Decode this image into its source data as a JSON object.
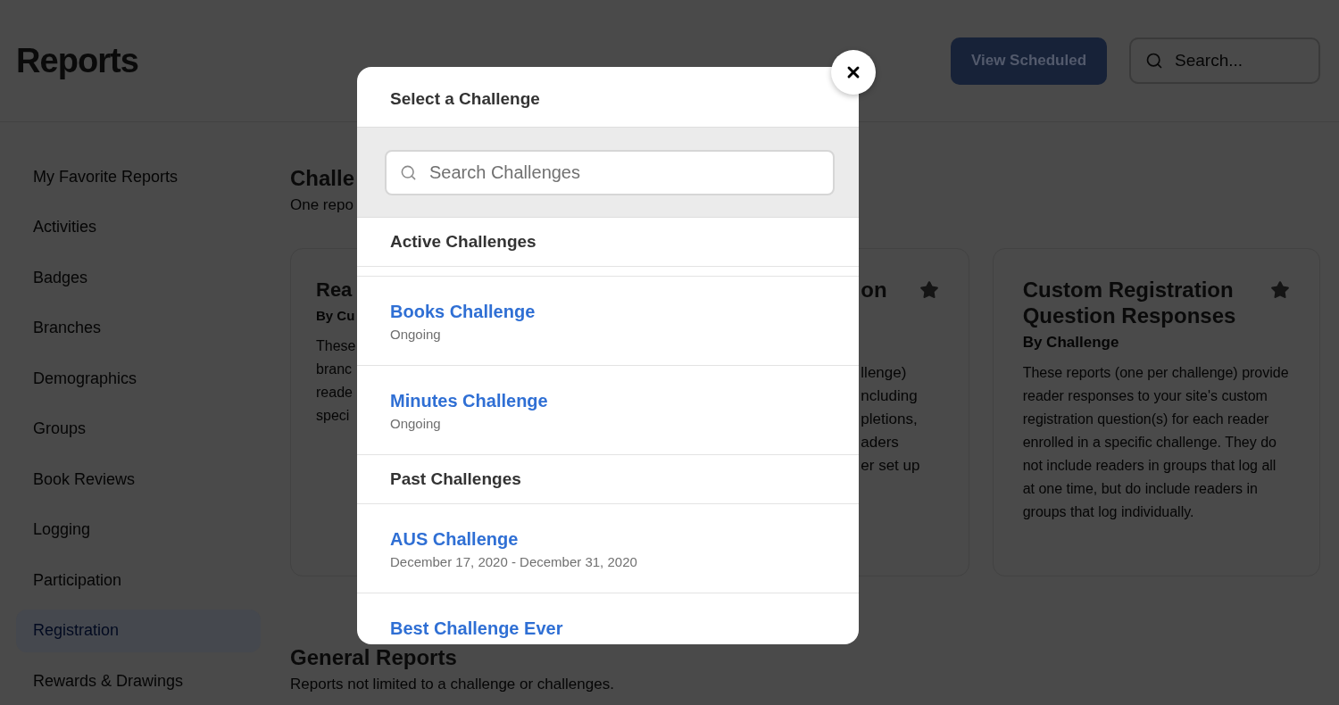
{
  "header": {
    "title": "Reports",
    "button": {
      "label": "View Scheduled"
    },
    "search": {
      "placeholder": "Search..."
    }
  },
  "sidebar": {
    "items": [
      {
        "label": "My Favorite Reports",
        "selected": false
      },
      {
        "label": "Activities",
        "selected": false
      },
      {
        "label": "Badges",
        "selected": false
      },
      {
        "label": "Branches",
        "selected": false
      },
      {
        "label": "Demographics",
        "selected": false
      },
      {
        "label": "Groups",
        "selected": false
      },
      {
        "label": "Book Reviews",
        "selected": false
      },
      {
        "label": "Logging",
        "selected": false
      },
      {
        "label": "Participation",
        "selected": false
      },
      {
        "label": "Registration",
        "selected": true
      },
      {
        "label": "Rewards & Drawings",
        "selected": false
      }
    ]
  },
  "sections": [
    {
      "title": "Challe",
      "subtitle": "One repo",
      "cards": [
        {
          "kind": "left_part",
          "title": "Rea",
          "subtitle": "By Cu",
          "lines": [
            "These",
            "branc",
            "reade",
            "speci"
          ]
        },
        {
          "kind": "right_part",
          "title": "on",
          "favorite": false,
          "lines": [
            "llenge)",
            "ncluding",
            "pletions,",
            "aders",
            "er set up"
          ]
        },
        {
          "kind": "full",
          "title": "Custom Registration Question Responses",
          "favorite": false,
          "subtitle": "By Challenge",
          "description": "These reports (one per challenge) provide reader responses to your site's custom registration question(s) for each reader enrolled in a specific challenge. They do not include readers in groups that log all at one time, but do include readers in groups that log individually."
        }
      ]
    },
    {
      "title": "General Reports",
      "subtitle": "Reports not limited to a challenge or challenges."
    }
  ],
  "dialog": {
    "title": "Select a Challenge",
    "search": {
      "placeholder": "Search Challenges"
    },
    "groups": [
      {
        "title": "Active Challenges",
        "items": [
          {
            "name": "Books Challenge",
            "detail": "Ongoing"
          },
          {
            "name": "Minutes Challenge",
            "detail": "Ongoing"
          }
        ]
      },
      {
        "title": "Past Challenges",
        "items": [
          {
            "name": "AUS Challenge",
            "detail": "December 17, 2020 - December 31, 2020"
          },
          {
            "name": "Best Challenge Ever"
          }
        ]
      }
    ]
  }
}
